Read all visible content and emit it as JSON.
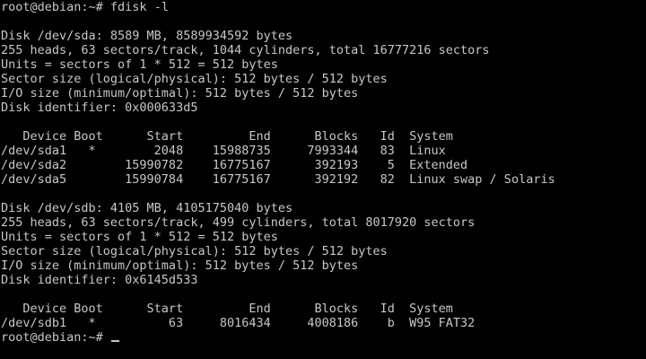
{
  "terminal": {
    "prompt": "root@debian:~# ",
    "command": "fdisk -l",
    "disk_sda": {
      "header": "Disk /dev/sda: 8589 MB, 8589934592 bytes",
      "geometry": "255 heads, 63 sectors/track, 1044 cylinders, total 16777216 sectors",
      "units": "Units = sectors of 1 * 512 = 512 bytes",
      "sector_size": "Sector size (logical/physical): 512 bytes / 512 bytes",
      "io_size": "I/O size (minimum/optimal): 512 bytes / 512 bytes",
      "identifier": "Disk identifier: 0x000633d5",
      "table_header": "   Device Boot      Start         End      Blocks   Id  System",
      "rows": [
        "/dev/sda1   *        2048    15988735     7993344   83  Linux",
        "/dev/sda2        15990782    16775167      392193    5  Extended",
        "/dev/sda5        15990784    16775167      392192   82  Linux swap / Solaris"
      ]
    },
    "disk_sdb": {
      "header": "Disk /dev/sdb: 4105 MB, 4105175040 bytes",
      "geometry": "255 heads, 63 sectors/track, 499 cylinders, total 8017920 sectors",
      "units": "Units = sectors of 1 * 512 = 512 bytes",
      "sector_size": "Sector size (logical/physical): 512 bytes / 512 bytes",
      "io_size": "I/O size (minimum/optimal): 512 bytes / 512 bytes",
      "identifier": "Disk identifier: 0x6145d533",
      "table_header": "   Device Boot      Start         End      Blocks   Id  System",
      "rows": [
        "/dev/sdb1   *          63     8016434     4008186    b  W95 FAT32"
      ]
    },
    "final_prompt": "root@debian:~# "
  }
}
